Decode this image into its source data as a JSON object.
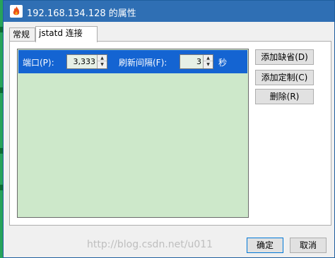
{
  "window": {
    "title": "192.168.134.128 的属性",
    "icon": "app-flame-icon"
  },
  "tabs": [
    {
      "label": "常规"
    },
    {
      "label": "jstatd 连接",
      "active": true
    }
  ],
  "connection": {
    "port_label": "端口(P):",
    "port_value": "3,333",
    "refresh_label": "刷新间隔(F):",
    "refresh_value": "3",
    "refresh_unit": "秒"
  },
  "side_buttons": {
    "add_default": "添加缺省(D)",
    "add_custom": "添加定制(C)",
    "delete": "删除(R)"
  },
  "footer": {
    "ok": "确定",
    "cancel": "取消"
  },
  "watermark": "http://blog.csdn.net/u011",
  "colors": {
    "titlebar": "#2f6fb4",
    "header_band": "#1464d2",
    "list_bg": "#cde8ca"
  }
}
